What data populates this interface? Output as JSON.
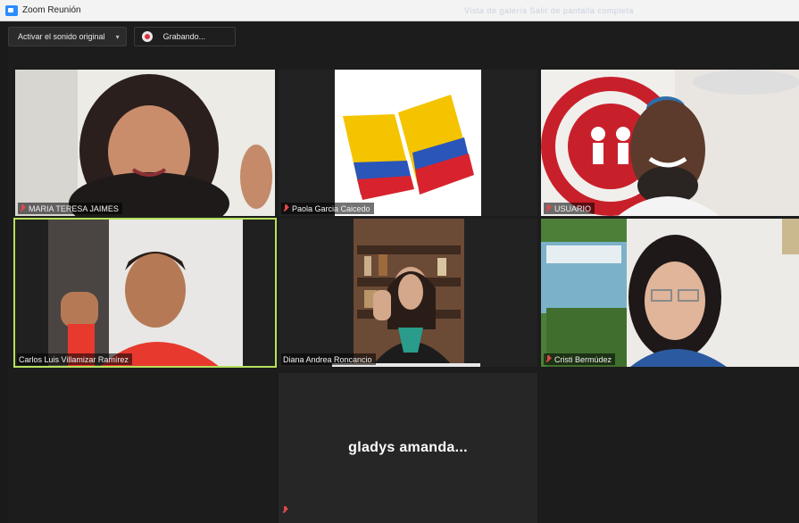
{
  "window": {
    "title": "Zoom Reunión",
    "faded_text": "Vista de galería   Salir de pantalla completa"
  },
  "topbar": {
    "audio_label": "Activar el sonido original",
    "recording_label": "Grabando..."
  },
  "colors": {
    "active_speaker_border": "#b6e15b",
    "muted_icon": "#e0494a"
  },
  "participants": [
    {
      "name": "MARIA TERESA JAIMES",
      "muted": true
    },
    {
      "name": "Paola Garcia Caicedo",
      "muted": true
    },
    {
      "name": "USUARIO",
      "muted": true
    },
    {
      "name": "Carlos Luis Villamizar Ramírez",
      "muted": false,
      "active": true
    },
    {
      "name": "Diana Andrea Roncancio",
      "muted": false
    },
    {
      "name": "Cristi Bermúdez",
      "muted": true
    },
    {
      "name": "gladys amanda...",
      "muted": true,
      "video_off": true
    }
  ]
}
